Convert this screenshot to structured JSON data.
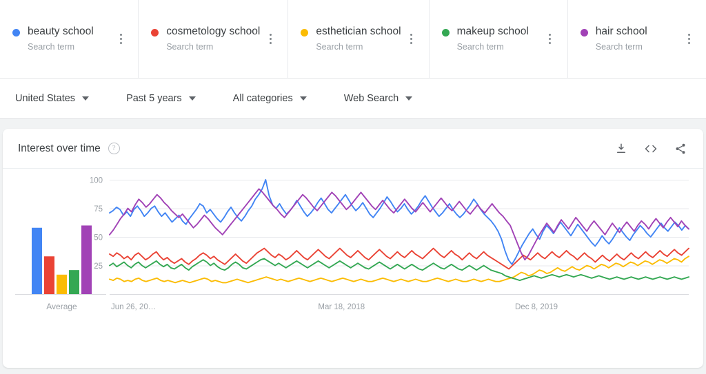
{
  "terms": [
    {
      "label": "beauty school",
      "sub": "Search term",
      "color": "#4285F4",
      "menu": "more-options"
    },
    {
      "label": "cosmetology school",
      "sub": "Search term",
      "color": "#EA4335",
      "menu": "more-options"
    },
    {
      "label": "esthetician school",
      "sub": "Search term",
      "color": "#FBBC04",
      "menu": "more-options"
    },
    {
      "label": "makeup school",
      "sub": "Search term",
      "color": "#34A853",
      "menu": "more-options"
    },
    {
      "label": "hair school",
      "sub": "Search term",
      "color": "#A142B6",
      "menu": "more-options"
    }
  ],
  "filters": [
    {
      "label": "United States"
    },
    {
      "label": "Past 5 years"
    },
    {
      "label": "All categories"
    },
    {
      "label": "Web Search"
    }
  ],
  "chart_card": {
    "title": "Interest over time",
    "help_icon": "help-circle-icon",
    "actions": [
      {
        "name": "download-icon",
        "title": "Download"
      },
      {
        "name": "embed-code-icon",
        "title": "Embed"
      },
      {
        "name": "share-icon",
        "title": "Share"
      }
    ]
  },
  "chart_data": {
    "type": "line",
    "title": "Interest over time",
    "xlabel": "",
    "ylabel": "",
    "ylim": [
      0,
      100
    ],
    "yticks": [
      25,
      50,
      75,
      100
    ],
    "grid": true,
    "legend_position": "top-cards",
    "xtick_labels": [
      "Jun 26, 20…",
      "Mar 18, 2018",
      "Dec 8, 2019"
    ],
    "average_panel": {
      "label": "Average",
      "values": [
        58,
        33,
        17,
        21,
        60
      ]
    },
    "series": [
      {
        "name": "beauty school",
        "color": "#4285F4",
        "values": [
          71,
          73,
          76,
          74,
          69,
          72,
          68,
          74,
          77,
          73,
          68,
          71,
          75,
          77,
          72,
          68,
          71,
          67,
          63,
          66,
          69,
          64,
          61,
          66,
          70,
          74,
          79,
          77,
          71,
          74,
          70,
          66,
          63,
          67,
          72,
          76,
          71,
          67,
          64,
          68,
          73,
          77,
          83,
          87,
          92,
          100,
          86,
          78,
          75,
          79,
          74,
          70,
          73,
          77,
          82,
          77,
          72,
          68,
          71,
          75,
          80,
          84,
          79,
          74,
          71,
          75,
          79,
          83,
          87,
          82,
          77,
          73,
          76,
          80,
          75,
          70,
          67,
          71,
          75,
          80,
          85,
          81,
          76,
          72,
          75,
          79,
          74,
          70,
          73,
          77,
          82,
          86,
          81,
          76,
          72,
          68,
          71,
          75,
          79,
          74,
          70,
          67,
          70,
          74,
          78,
          83,
          79,
          74,
          70,
          67,
          64,
          60,
          55,
          48,
          38,
          30,
          26,
          31,
          37,
          43,
          48,
          53,
          57,
          52,
          48,
          55,
          60,
          57,
          53,
          58,
          63,
          59,
          55,
          51,
          56,
          61,
          57,
          53,
          49,
          45,
          42,
          46,
          51,
          47,
          44,
          48,
          53,
          58,
          54,
          50,
          47,
          52,
          56,
          60,
          57,
          53,
          50,
          54,
          58,
          62,
          58,
          55,
          59,
          63,
          60,
          56,
          60,
          57
        ]
      },
      {
        "name": "cosmetology school",
        "color": "#EA4335",
        "values": [
          35,
          33,
          36,
          34,
          31,
          33,
          30,
          34,
          36,
          33,
          30,
          32,
          35,
          37,
          33,
          30,
          32,
          29,
          27,
          29,
          31,
          28,
          26,
          29,
          31,
          34,
          36,
          34,
          31,
          33,
          30,
          28,
          26,
          29,
          32,
          35,
          32,
          29,
          27,
          30,
          33,
          36,
          38,
          40,
          37,
          34,
          32,
          35,
          33,
          30,
          32,
          35,
          38,
          35,
          32,
          30,
          33,
          36,
          39,
          36,
          33,
          31,
          34,
          37,
          40,
          37,
          34,
          32,
          35,
          38,
          35,
          32,
          30,
          33,
          36,
          39,
          36,
          33,
          31,
          34,
          37,
          34,
          32,
          35,
          38,
          35,
          33,
          31,
          34,
          37,
          40,
          37,
          34,
          32,
          35,
          38,
          35,
          33,
          30,
          33,
          36,
          33,
          31,
          34,
          37,
          34,
          32,
          30,
          28,
          26,
          24,
          22,
          25,
          28,
          31,
          34,
          32,
          30,
          33,
          36,
          33,
          31,
          34,
          37,
          34,
          32,
          35,
          38,
          35,
          33,
          30,
          33,
          36,
          33,
          31,
          28,
          31,
          34,
          31,
          29,
          32,
          35,
          32,
          30,
          33,
          36,
          33,
          31,
          34,
          37,
          34,
          32,
          35,
          38,
          35,
          33,
          36,
          39,
          36,
          34,
          37,
          40
        ]
      },
      {
        "name": "esthetician school",
        "color": "#FBBC04",
        "values": [
          13,
          12,
          14,
          13,
          11,
          12,
          11,
          13,
          14,
          12,
          11,
          12,
          13,
          14,
          12,
          11,
          12,
          11,
          10,
          11,
          12,
          11,
          10,
          11,
          12,
          13,
          14,
          13,
          11,
          12,
          11,
          10,
          10,
          11,
          12,
          13,
          12,
          11,
          10,
          11,
          12,
          13,
          14,
          15,
          14,
          13,
          12,
          13,
          12,
          11,
          12,
          13,
          14,
          13,
          12,
          11,
          12,
          13,
          14,
          13,
          12,
          11,
          12,
          13,
          14,
          13,
          12,
          11,
          12,
          13,
          12,
          11,
          11,
          12,
          13,
          14,
          13,
          12,
          11,
          12,
          13,
          12,
          11,
          12,
          13,
          12,
          11,
          11,
          12,
          13,
          14,
          13,
          12,
          11,
          12,
          13,
          12,
          11,
          11,
          12,
          13,
          12,
          11,
          12,
          13,
          12,
          11,
          11,
          12,
          13,
          14,
          15,
          17,
          19,
          18,
          16,
          17,
          19,
          21,
          20,
          18,
          19,
          21,
          23,
          21,
          20,
          22,
          24,
          22,
          21,
          23,
          25,
          24,
          22,
          24,
          26,
          25,
          23,
          25,
          27,
          26,
          24,
          26,
          28,
          27,
          25,
          27,
          29,
          28,
          26,
          28,
          30,
          29,
          27,
          29,
          31,
          30,
          28,
          31,
          33
        ]
      },
      {
        "name": "makeup school",
        "color": "#34A853",
        "values": [
          25,
          27,
          24,
          26,
          28,
          25,
          23,
          26,
          28,
          25,
          23,
          25,
          27,
          29,
          26,
          24,
          26,
          23,
          22,
          24,
          26,
          23,
          21,
          24,
          26,
          28,
          30,
          28,
          25,
          27,
          24,
          22,
          21,
          23,
          26,
          28,
          26,
          23,
          22,
          24,
          26,
          28,
          30,
          31,
          29,
          27,
          25,
          27,
          25,
          23,
          25,
          27,
          29,
          27,
          25,
          23,
          25,
          27,
          29,
          27,
          25,
          23,
          25,
          27,
          29,
          27,
          25,
          23,
          25,
          27,
          25,
          23,
          22,
          24,
          26,
          28,
          26,
          24,
          22,
          24,
          26,
          24,
          22,
          24,
          26,
          24,
          22,
          21,
          23,
          25,
          27,
          25,
          23,
          22,
          24,
          26,
          24,
          22,
          21,
          23,
          25,
          23,
          21,
          23,
          25,
          23,
          21,
          20,
          19,
          18,
          16,
          15,
          14,
          13,
          12,
          13,
          14,
          15,
          16,
          15,
          14,
          15,
          16,
          17,
          16,
          15,
          16,
          17,
          16,
          15,
          16,
          17,
          16,
          15,
          14,
          15,
          16,
          15,
          14,
          13,
          14,
          15,
          14,
          13,
          14,
          15,
          14,
          13,
          14,
          15,
          14,
          13,
          14,
          15,
          14,
          13,
          14,
          15,
          14,
          13,
          14,
          15
        ]
      },
      {
        "name": "hair school",
        "color": "#A142B6",
        "values": [
          52,
          56,
          61,
          66,
          70,
          75,
          72,
          78,
          83,
          80,
          76,
          79,
          83,
          87,
          84,
          80,
          77,
          73,
          70,
          67,
          70,
          66,
          62,
          58,
          61,
          65,
          69,
          66,
          62,
          58,
          55,
          52,
          56,
          60,
          64,
          68,
          72,
          76,
          80,
          84,
          88,
          92,
          89,
          85,
          81,
          77,
          74,
          70,
          67,
          71,
          75,
          79,
          83,
          87,
          84,
          80,
          76,
          73,
          77,
          81,
          85,
          89,
          86,
          82,
          78,
          74,
          77,
          81,
          85,
          89,
          85,
          81,
          77,
          74,
          78,
          82,
          78,
          74,
          71,
          75,
          79,
          83,
          79,
          75,
          72,
          76,
          80,
          76,
          72,
          76,
          80,
          84,
          80,
          76,
          73,
          77,
          81,
          77,
          73,
          70,
          74,
          78,
          74,
          71,
          75,
          79,
          75,
          71,
          68,
          64,
          60,
          52,
          44,
          36,
          30,
          34,
          40,
          46,
          52,
          57,
          62,
          58,
          54,
          60,
          65,
          61,
          57,
          62,
          67,
          63,
          59,
          55,
          60,
          64,
          60,
          56,
          52,
          57,
          62,
          58,
          54,
          59,
          63,
          59,
          55,
          60,
          64,
          61,
          57,
          62,
          66,
          62,
          58,
          63,
          67,
          63,
          59,
          64,
          60,
          57
        ]
      }
    ]
  }
}
